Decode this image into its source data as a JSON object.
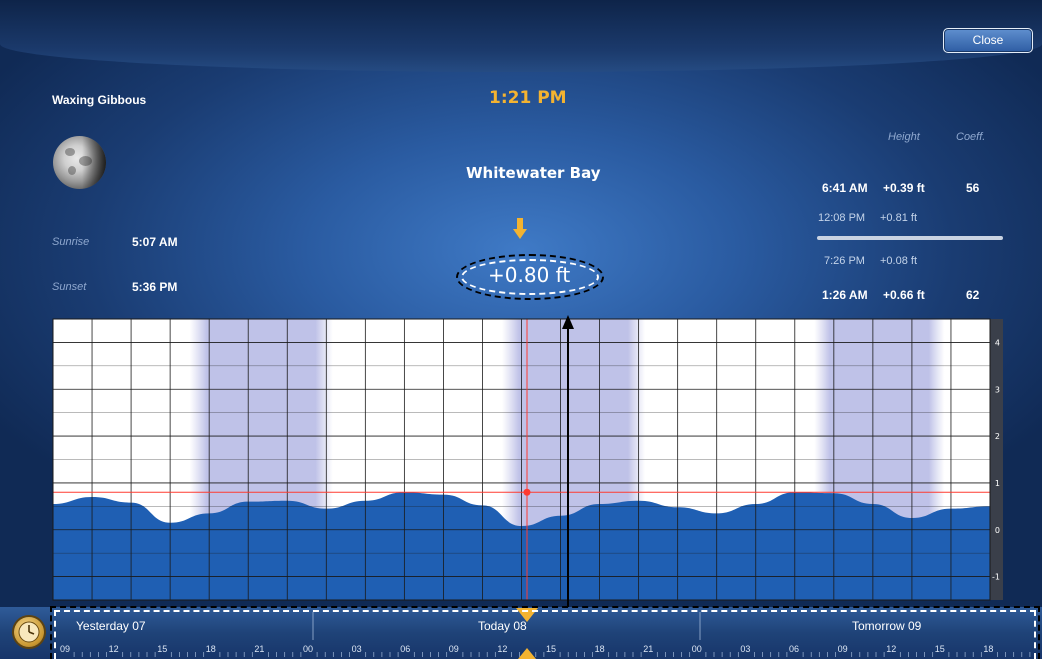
{
  "window": {
    "close_label": "Close"
  },
  "moon": {
    "phase": "Waxing Gibbous",
    "icon": "moon-icon"
  },
  "sun": {
    "sunrise_label": "Sunrise",
    "sunrise": "5:07 AM",
    "sunset_label": "Sunset",
    "sunset": "5:36 PM"
  },
  "current": {
    "time": "1:21 PM",
    "location": "Whitewater Bay",
    "height": "+0.80 ft"
  },
  "tide_table": {
    "height_header": "Height",
    "coeff_header": "Coeff.",
    "rows": [
      {
        "time": "6:41 AM",
        "height": "+0.39 ft",
        "coeff": "56"
      },
      {
        "time": "12:08 PM",
        "height": "+0.81 ft",
        "coeff": ""
      },
      {
        "time": "7:26 PM",
        "height": "+0.08 ft",
        "coeff": ""
      },
      {
        "time": "1:26 AM",
        "height": "+0.66 ft",
        "coeff": "62"
      }
    ]
  },
  "chart_data": {
    "type": "area",
    "y_ticks": [
      "4",
      "3",
      "2",
      "1",
      "0",
      "-1"
    ],
    "ylim": [
      -1.5,
      4.5
    ],
    "current_value": 0.8,
    "fill_color": "#1f5fb3",
    "marker_color": "#ff3b30",
    "x_hours": [
      0,
      3,
      6,
      9,
      12,
      15,
      18,
      21,
      24,
      27,
      30,
      33,
      36,
      39,
      42,
      45,
      48,
      51,
      54,
      57,
      60,
      63,
      66,
      69,
      72
    ],
    "y_values": [
      0.55,
      0.7,
      0.58,
      0.15,
      0.35,
      0.6,
      0.62,
      0.45,
      0.62,
      0.8,
      0.75,
      0.52,
      0.08,
      0.3,
      0.55,
      0.62,
      0.48,
      0.35,
      0.55,
      0.8,
      0.78,
      0.55,
      0.25,
      0.45,
      0.5
    ]
  },
  "timeline": {
    "days": [
      "Yesterday 07",
      "Today 08",
      "Tomorrow 09"
    ],
    "ticks": [
      "09",
      "12",
      "15",
      "18",
      "21",
      "00",
      "03",
      "06",
      "09",
      "12",
      "15",
      "18",
      "21",
      "00",
      "03",
      "06",
      "09",
      "12",
      "15",
      "18"
    ]
  }
}
